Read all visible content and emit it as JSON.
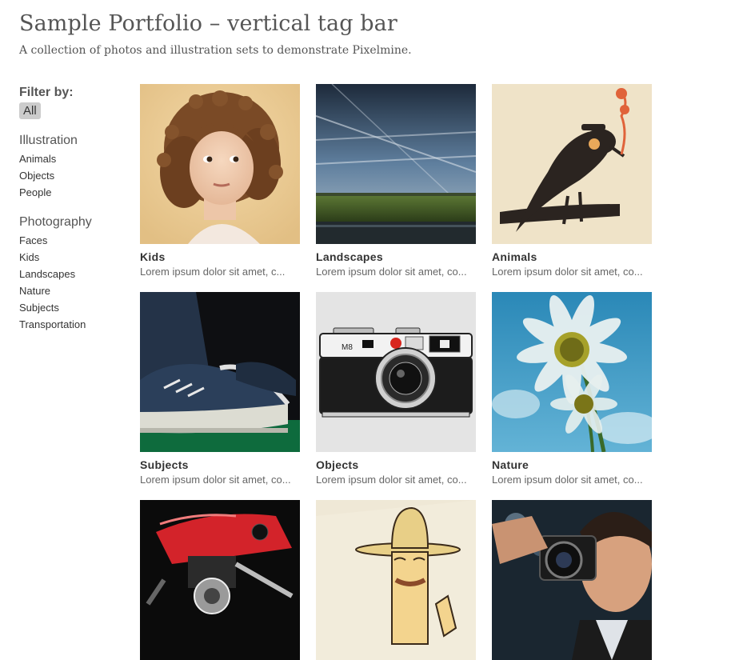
{
  "header": {
    "title": "Sample Portfolio – vertical tag bar",
    "subtitle": "A collection of photos and illustration sets to demonstrate Pixelmine."
  },
  "filter": {
    "heading": "Filter by:",
    "all_label": "All",
    "groups": [
      {
        "title": "Illustration",
        "items": [
          "Animals",
          "Objects",
          "People"
        ]
      },
      {
        "title": "Photography",
        "items": [
          "Faces",
          "Kids",
          "Landscapes",
          "Nature",
          "Subjects",
          "Transportation"
        ]
      }
    ]
  },
  "portfolio": {
    "items": [
      {
        "title": "Kids",
        "desc": "Lorem ipsum dolor sit amet, c...",
        "icon": "girl-portrait-photo"
      },
      {
        "title": "Landscapes",
        "desc": "Lorem ipsum dolor sit amet, co...",
        "icon": "landscape-photo"
      },
      {
        "title": "Animals",
        "desc": "Lorem ipsum dolor sit amet, co...",
        "icon": "bird-illustration"
      },
      {
        "title": "Subjects",
        "desc": "Lorem ipsum dolor sit amet, co...",
        "icon": "sneakers-photo"
      },
      {
        "title": "Objects",
        "desc": "Lorem ipsum dolor sit amet, co...",
        "icon": "camera-illustration"
      },
      {
        "title": "Nature",
        "desc": "Lorem ipsum dolor sit amet, co...",
        "icon": "daisy-photo"
      },
      {
        "title": "",
        "desc": "",
        "icon": "motorcycle-photo"
      },
      {
        "title": "",
        "desc": "",
        "icon": "cowboy-illustration"
      },
      {
        "title": "",
        "desc": "",
        "icon": "photographer-photo"
      }
    ]
  }
}
